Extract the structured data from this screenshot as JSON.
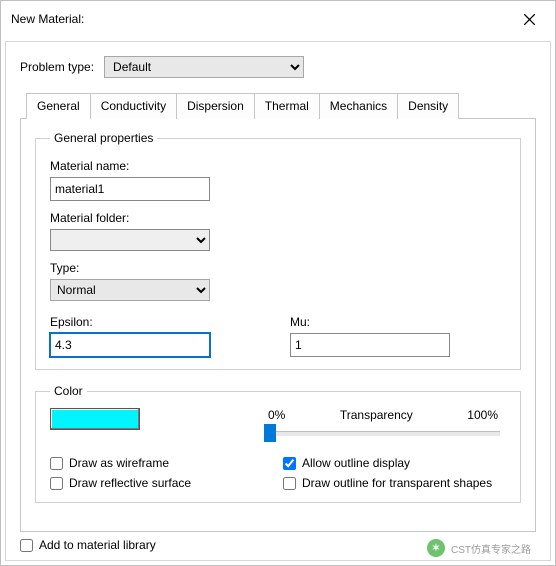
{
  "window": {
    "title": "New Material:"
  },
  "problem": {
    "label": "Problem type:",
    "value": "Default"
  },
  "tabs": {
    "items": [
      {
        "label": "General"
      },
      {
        "label": "Conductivity"
      },
      {
        "label": "Dispersion"
      },
      {
        "label": "Thermal"
      },
      {
        "label": "Mechanics"
      },
      {
        "label": "Density"
      }
    ],
    "active_index": 0
  },
  "general_panel": {
    "groupbox_title": "General properties",
    "material_name_label": "Material name:",
    "material_name_value": "material1",
    "material_folder_label": "Material folder:",
    "material_folder_value": "",
    "type_label": "Type:",
    "type_value": "Normal",
    "epsilon_label": "Epsilon:",
    "epsilon_value": "4.3",
    "mu_label": "Mu:",
    "mu_value": "1"
  },
  "color_panel": {
    "groupbox_title": "Color",
    "swatch_hex": "#00F5FF",
    "transp_left": "0%",
    "transp_mid": "Transparency",
    "transp_right": "100%",
    "transparency_value": 0,
    "draw_wireframe_label": "Draw as wireframe",
    "draw_wireframe_checked": false,
    "allow_outline_label": "Allow outline display",
    "allow_outline_checked": true,
    "draw_reflective_label": "Draw reflective surface",
    "draw_reflective_checked": false,
    "draw_outline_transparent_label": "Draw outline for transparent shapes",
    "draw_outline_transparent_checked": false
  },
  "bottom": {
    "add_to_library_label": "Add to material library",
    "add_to_library_checked": false
  },
  "watermark": {
    "text": "CST仿真专家之路"
  }
}
